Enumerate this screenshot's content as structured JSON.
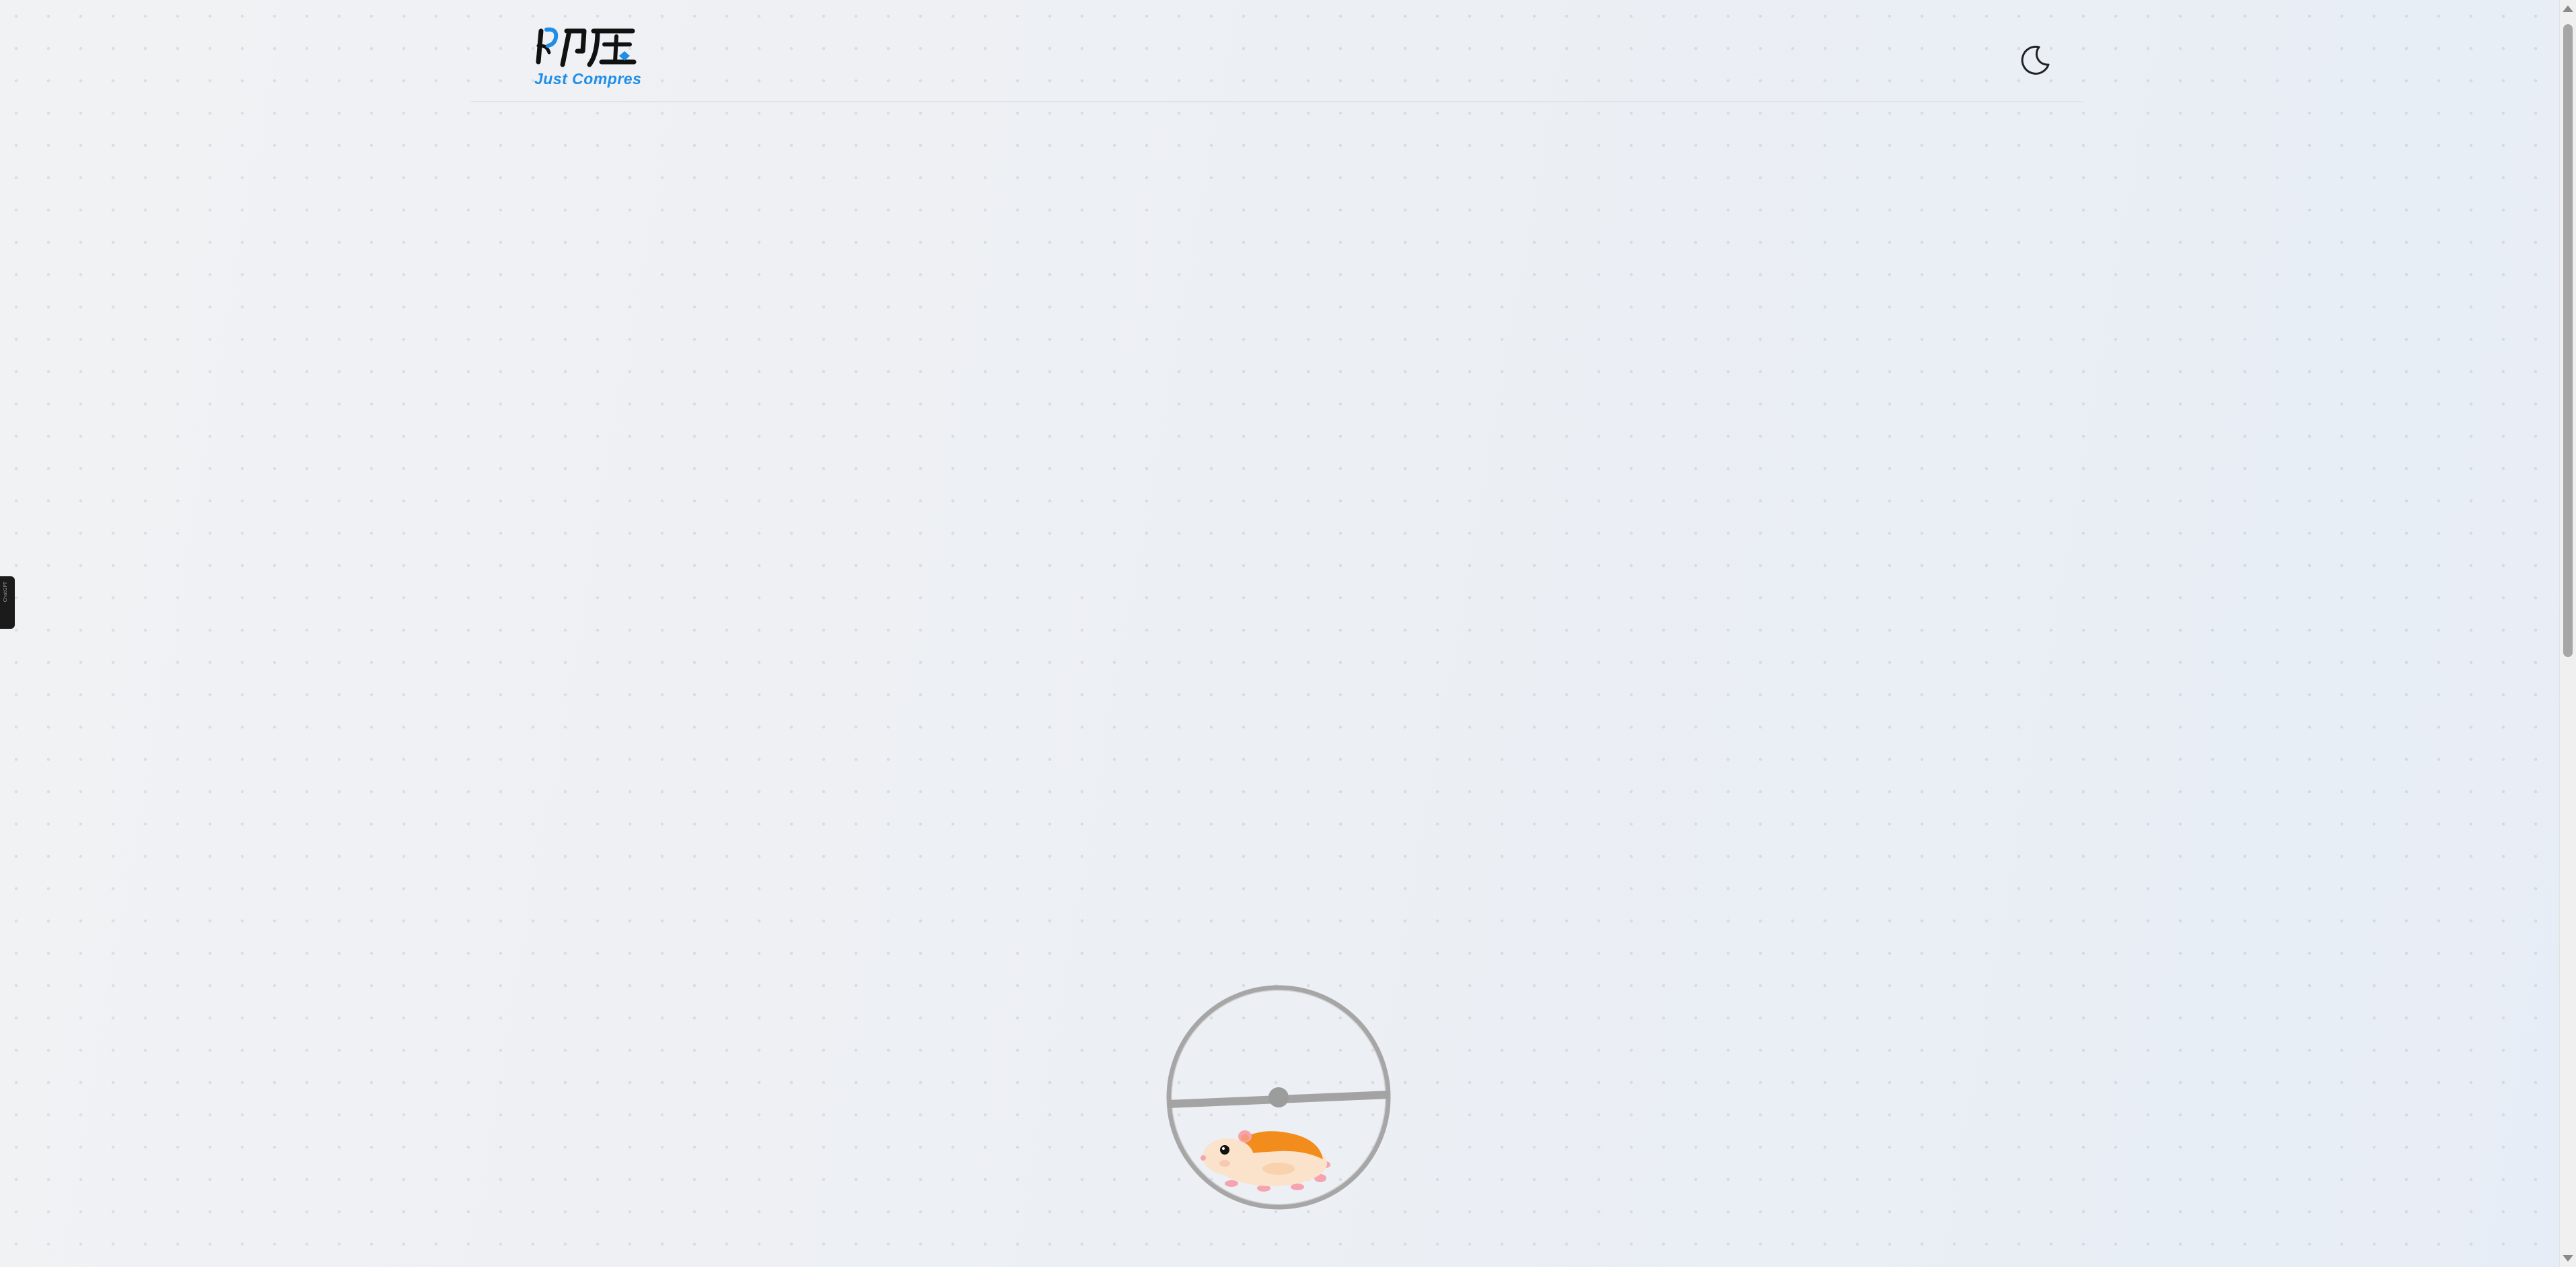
{
  "header": {
    "logo": {
      "mark_text": "即压",
      "tagline": "Just Compres",
      "brand_color": "#1f8ee8"
    },
    "theme_toggle": {
      "icon": "moon-icon"
    }
  },
  "side_tab": {
    "label": "ChatGPT"
  },
  "loader": {
    "icon": "hamster-wheel-loading-icon"
  },
  "colors": {
    "background": "#eef1f5",
    "divider": "#dfe3ea",
    "hamster_orange": "#f28c1c",
    "hamster_cream": "#fbe3cb"
  }
}
